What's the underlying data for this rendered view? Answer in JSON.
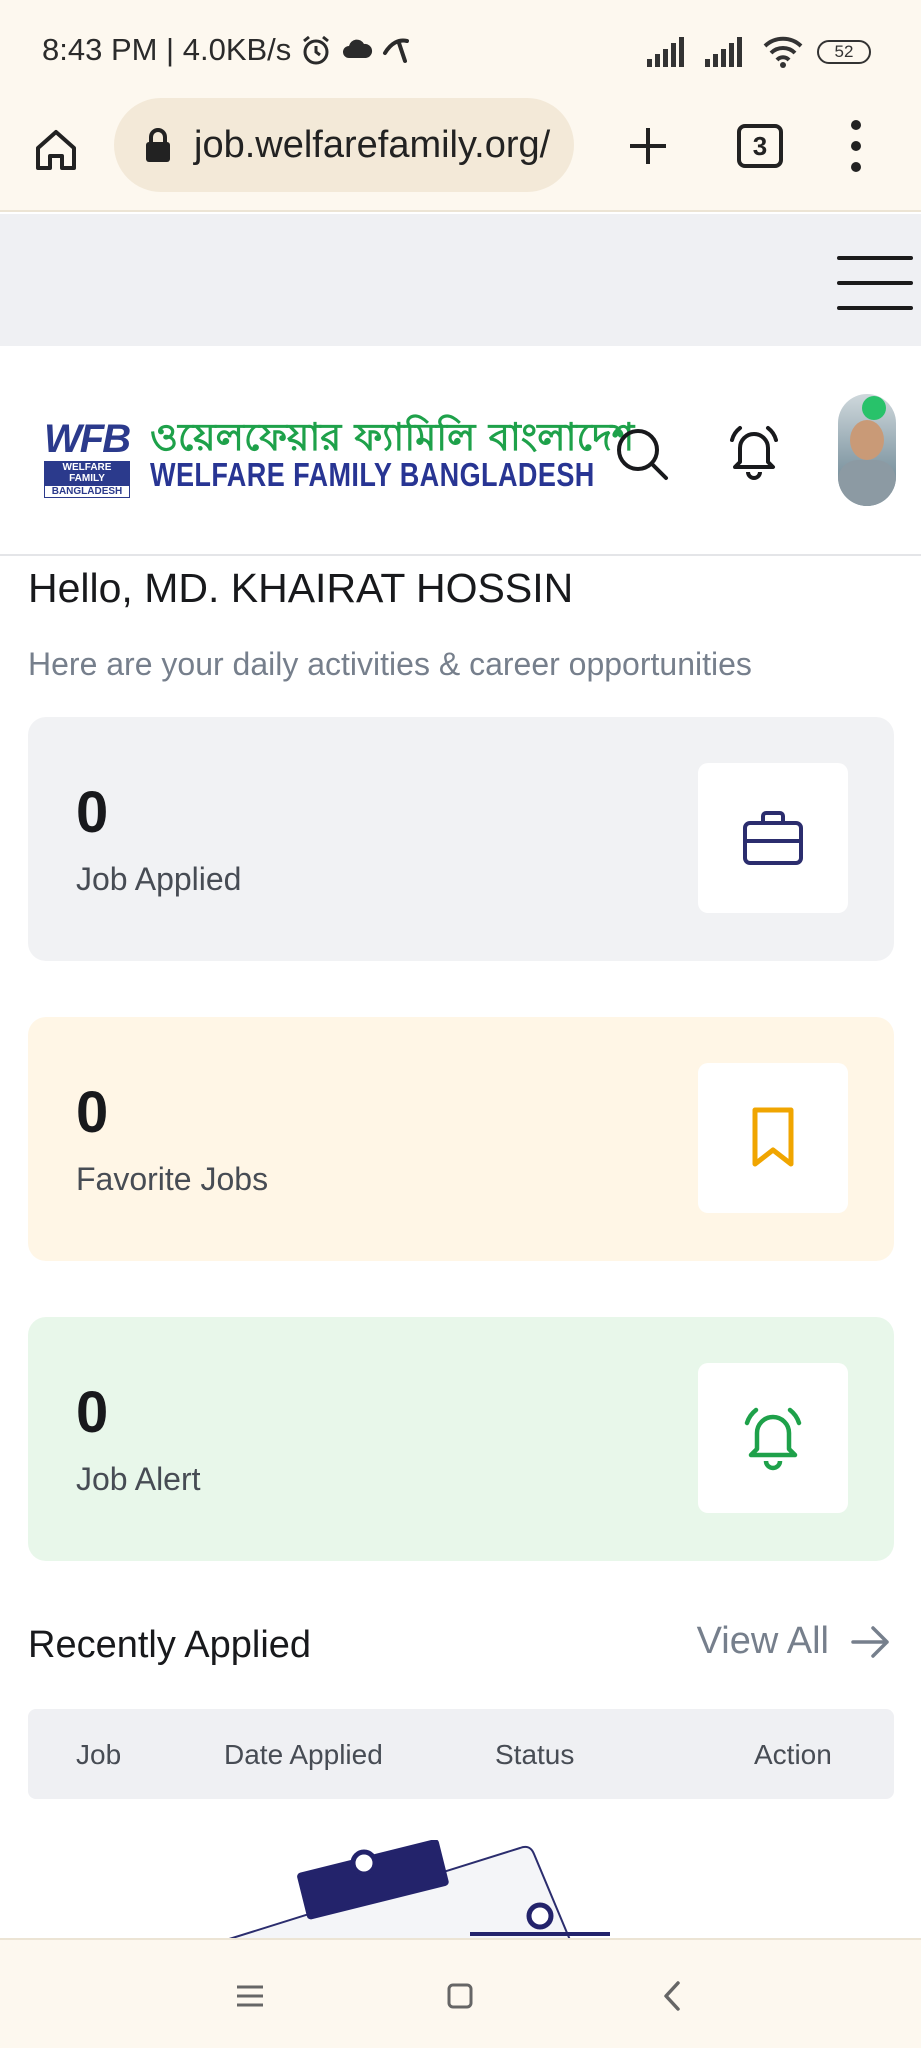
{
  "status_bar": {
    "time_and_speed": "8:43 PM | 4.0KB/s",
    "battery": "52"
  },
  "browser": {
    "url": "job.welfarefamily.org/",
    "tab_count": "3"
  },
  "header": {
    "logo_mark": "WFB",
    "logo_mark_sub1": "WELFARE FAMILY",
    "logo_mark_sub2": "BANGLADESH",
    "logo_bn": "ওয়েলফেয়ার ফ্যামিলি বাংলাদেশ",
    "logo_en": "WELFARE FAMILY BANGLADESH"
  },
  "dashboard": {
    "greeting": "Hello, MD. KHAIRAT HOSSIN",
    "subtitle": "Here are your daily activities & career opportunities",
    "cards": [
      {
        "count": "0",
        "label": "Job Applied",
        "icon": "briefcase-icon",
        "accent": "#2b2d6e"
      },
      {
        "count": "0",
        "label": "Favorite Jobs",
        "icon": "bookmark-icon",
        "accent": "#f0a500"
      },
      {
        "count": "0",
        "label": "Job Alert",
        "icon": "bell-icon",
        "accent": "#1ea14a"
      }
    ]
  },
  "recent": {
    "title": "Recently Applied",
    "view_all": "View All",
    "columns": [
      "Job",
      "Date Applied",
      "Status",
      "Action"
    ]
  },
  "colors": {
    "brand_blue": "#283593",
    "brand_green": "#1ea14a",
    "online": "#28c26a"
  }
}
